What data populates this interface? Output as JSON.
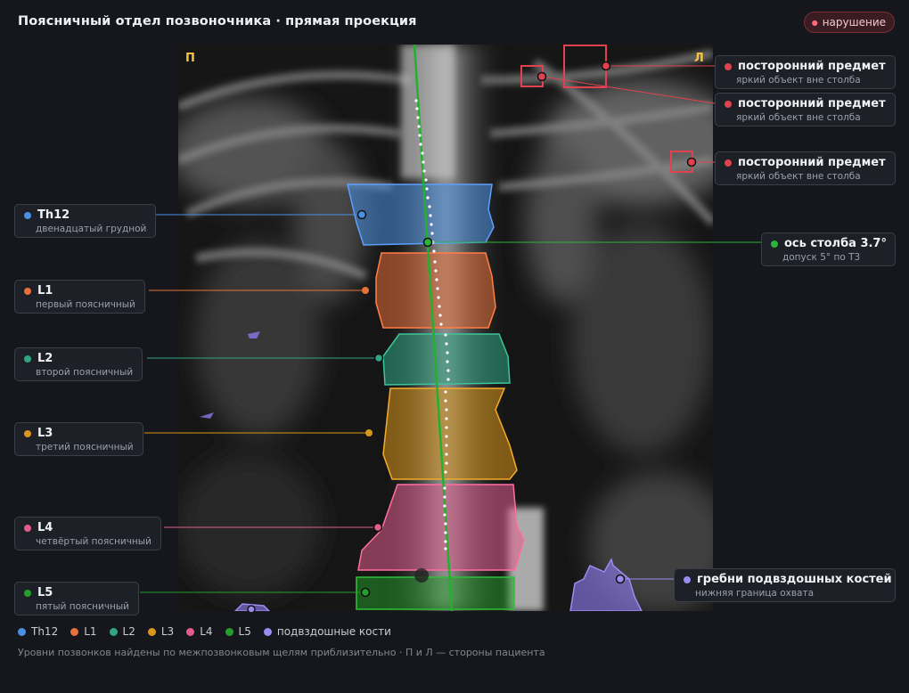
{
  "header": {
    "title": "Поясничный отдел позвоночника · прямая проекция",
    "badge": "нарушение"
  },
  "image": {
    "side_right_marker": "П",
    "side_left_marker": "Л"
  },
  "vertebrae": [
    {
      "id": "th12",
      "label": "Th12",
      "sub": "двенадцатый грудной",
      "color": "#4a90e2"
    },
    {
      "id": "l1",
      "label": "L1",
      "sub": "первый поясничный",
      "color": "#e8703a"
    },
    {
      "id": "l2",
      "label": "L2",
      "sub": "второй поясничный",
      "color": "#2fa582"
    },
    {
      "id": "l3",
      "label": "L3",
      "sub": "третий поясничный",
      "color": "#d9961c"
    },
    {
      "id": "l4",
      "label": "L4",
      "sub": "четвёртый поясничный",
      "color": "#e25c8c"
    },
    {
      "id": "l5",
      "label": "L5",
      "sub": "пятый поясничный",
      "color": "#24a02a"
    }
  ],
  "foreign_objects": [
    {
      "label": "посторонний предмет",
      "sub": "яркий объект вне столба",
      "color": "#e0434f"
    },
    {
      "label": "посторонний предмет",
      "sub": "яркий объект вне столба",
      "color": "#e0434f"
    },
    {
      "label": "посторонний предмет",
      "sub": "яркий объект вне столба",
      "color": "#e0434f"
    }
  ],
  "axis": {
    "label": "ось столба 3.7°",
    "sub": "допуск 5° по Т3",
    "color": "#2bb33a"
  },
  "iliac": {
    "label": "гребни подвздошных костей",
    "sub": "нижняя граница охвата",
    "color": "#9a8cf0"
  },
  "legend": [
    {
      "label": "Th12",
      "color": "#4a90e2"
    },
    {
      "label": "L1",
      "color": "#e8703a"
    },
    {
      "label": "L2",
      "color": "#2fa582"
    },
    {
      "label": "L3",
      "color": "#d9961c"
    },
    {
      "label": "L4",
      "color": "#e25c8c"
    },
    {
      "label": "L5",
      "color": "#24a02a"
    },
    {
      "label": "подвздошные кости",
      "color": "#9a8cf0"
    }
  ],
  "footnote": "Уровни позвонков найдены по межпозвонковым щелям приблизительно · П и Л — стороны пациента"
}
